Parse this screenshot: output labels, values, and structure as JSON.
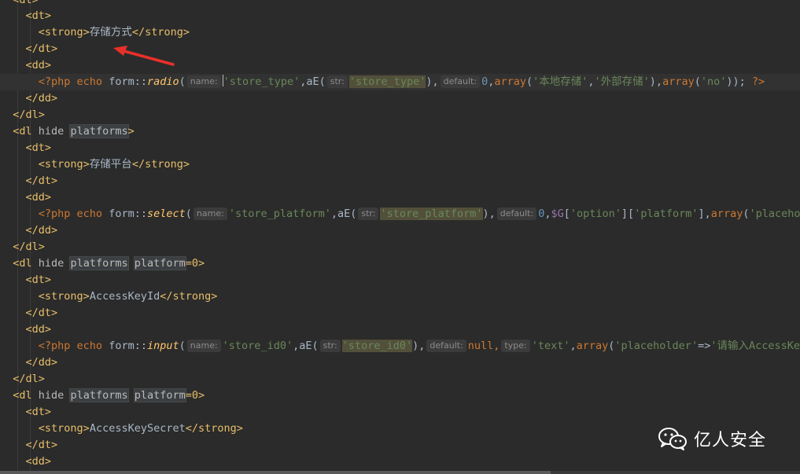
{
  "code": {
    "open_dt": "<dt>",
    "close_dt": "</dt>",
    "open_dd": "<dd>",
    "close_dd": "</dd>",
    "close_dl": "</dl>",
    "dl_close_fragment": "<dl>",
    "strong_open": "<strong>",
    "strong_close": "</strong>",
    "label_store_type": "存储方式",
    "label_store_platform": "存储平台",
    "label_access_key_id": "AccessKeyId",
    "label_access_key_secret": "AccessKeySecret",
    "dl_open": "<dl",
    "attr_hide": " hide ",
    "attr_platforms": "platforms",
    "attr_platform": "platform",
    "attr_eq0": "=0",
    "tag_end": ">",
    "php_open": "<?php",
    "echo": " echo ",
    "form": "form::",
    "fn_radio": "radio",
    "fn_select": "select",
    "fn_input": "input",
    "paren_open": "(",
    "aE_open": ",aE(",
    "hint_name": "name:",
    "hint_str": "str:",
    "hint_default": "default:",
    "hint_type": "type:",
    "line1": {
      "name_val": "'store_type'",
      "str_val": "'store_type'",
      "after_str": "),",
      "default_val": "0",
      "comma": ",",
      "array_kw": "array",
      "arr_open": "(",
      "opt1": "'本地存储'",
      "opt_sep": ",",
      "opt2": "'外部存储'",
      "arr_close": "),",
      "array_kw2": "array",
      "arr2_open": "(",
      "no": "'no'",
      "tail": "));",
      "php_close": " ?>"
    },
    "line2": {
      "name_val": "'store_platform'",
      "str_val": "'store_platform'",
      "after_str": "),",
      "default_val": "0",
      "comma": ",",
      "var": "$G",
      "idx1_open": "[",
      "idx1": "'option'",
      "idx1_close": "][",
      "idx2": "'platform'",
      "idx2_close": "],",
      "array_kw": "array",
      "arr_open": "(",
      "ph": "'placehol"
    },
    "line3": {
      "name_val": "'store_id0'",
      "str_val": "'store_id0'",
      "after_str": "),",
      "default_val": "null,",
      "type_val": "'text'",
      "comma": ",",
      "array_kw": "array",
      "arr_open": "(",
      "ph_key": "'placeholder'",
      "arrow": "=>",
      "ph_val": "'请输入AccessKey"
    }
  },
  "watermark": {
    "icon": "wechat-icon",
    "text": "亿人安全"
  },
  "colors": {
    "background": "#2b2b2b",
    "tag": "#e8bf6a",
    "string": "#6a8759",
    "keyword": "#cc7832",
    "arrow": "#e8302a"
  }
}
